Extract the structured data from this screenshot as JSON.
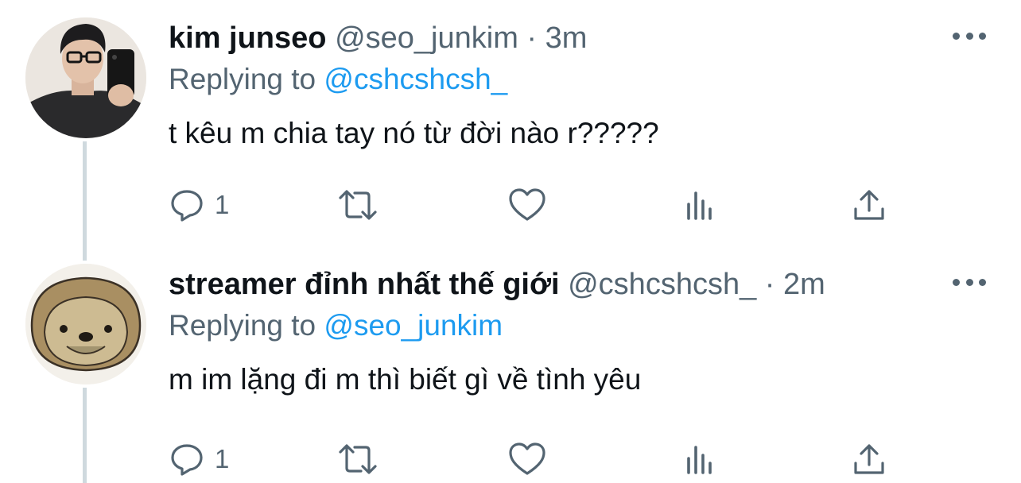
{
  "colors": {
    "link": "#1d9bf0",
    "secondary_text": "#536471",
    "thread_line": "#cfd9de"
  },
  "tweets": [
    {
      "display_name": "kim junseo",
      "handle": "@seo_junkim",
      "separator": "·",
      "time": "3m",
      "replying_label": "Replying to",
      "replying_to": "@cshcshcsh_",
      "text": "t kêu m chia tay nó từ đời nào r?????",
      "reply_count": "1",
      "avatar_icon": "person-photo-avatar",
      "icons": [
        "reply-icon",
        "retweet-icon",
        "like-icon",
        "views-icon",
        "share-icon",
        "more-icon"
      ]
    },
    {
      "display_name": "streamer đỉnh nhất thế giới",
      "handle": "@cshcshcsh_",
      "separator": "·",
      "time": "2m",
      "replying_label": "Replying to",
      "replying_to": "@seo_junkim",
      "text": "m im lặng đi m thì biết gì về tình yêu",
      "reply_count": "1",
      "avatar_icon": "sloth-avatar",
      "icons": [
        "reply-icon",
        "retweet-icon",
        "like-icon",
        "views-icon",
        "share-icon",
        "more-icon"
      ]
    }
  ]
}
